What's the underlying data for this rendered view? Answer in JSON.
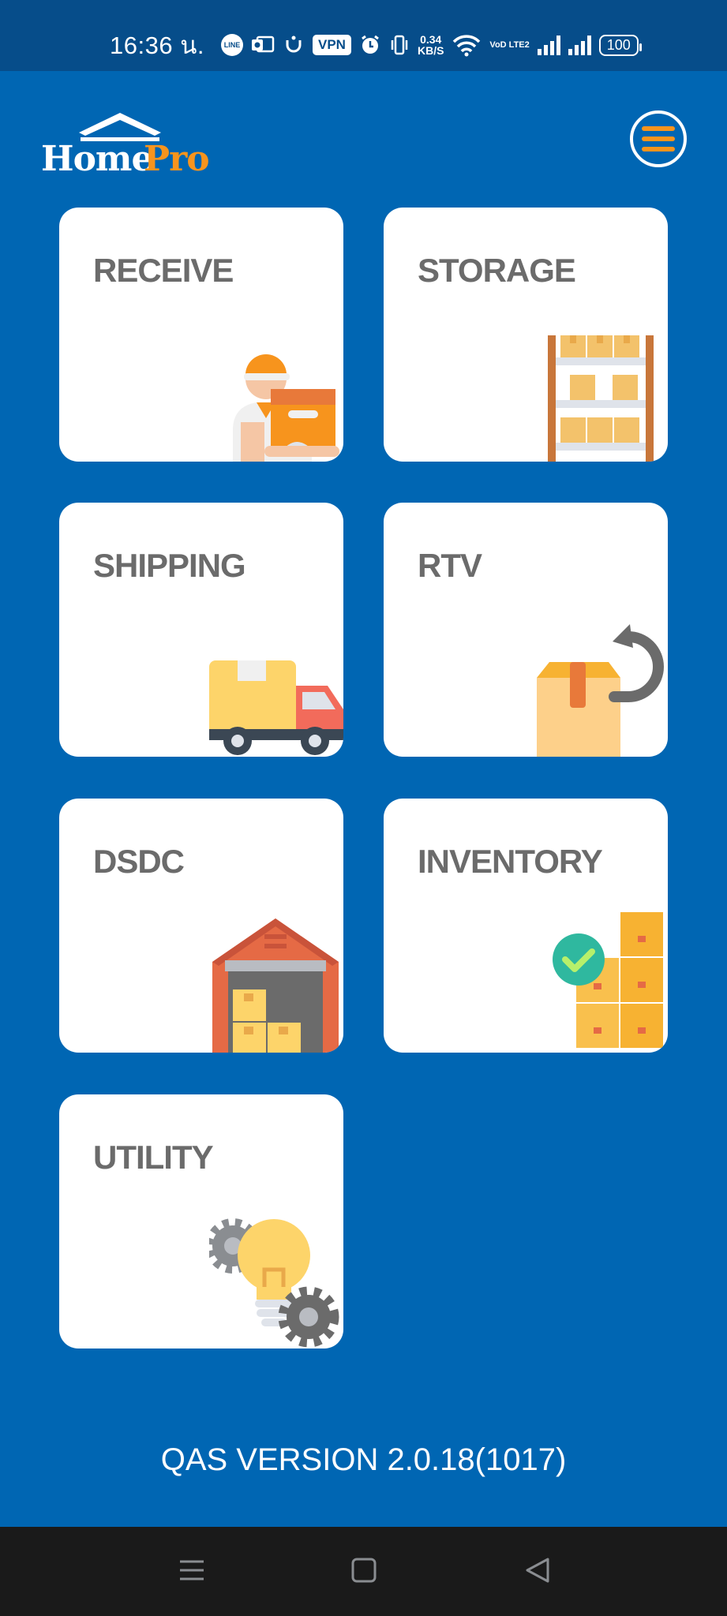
{
  "status_bar": {
    "time": "16:36 น.",
    "line_icon": "LINE",
    "vpn": "VPN",
    "net_speed_value": "0.34",
    "net_speed_unit": "KB/S",
    "volte": "VoD LTE2",
    "battery": "100",
    "icons": [
      "line-icon",
      "outlook-icon",
      "u-icon",
      "vpn-icon",
      "alarm-icon",
      "vibrate-icon",
      "wifi-icon",
      "signal-icon",
      "signal-icon",
      "battery-icon"
    ]
  },
  "header": {
    "logo_home": "Home",
    "logo_pro": "Pro",
    "menu_icon": "hamburger-menu-icon"
  },
  "menu_tiles": [
    {
      "label": "RECEIVE",
      "icon": "delivery-man-icon"
    },
    {
      "label": "STORAGE",
      "icon": "storage-shelf-icon"
    },
    {
      "label": "SHIPPING",
      "icon": "truck-icon"
    },
    {
      "label": "RTV",
      "icon": "return-box-icon"
    },
    {
      "label": "DSDC",
      "icon": "warehouse-icon"
    },
    {
      "label": "INVENTORY",
      "icon": "inventory-boxes-icon"
    },
    {
      "label": "UTILITY",
      "icon": "lightbulb-gears-icon"
    }
  ],
  "footer": {
    "version": "QAS VERSION 2.0.18(1017)"
  },
  "nav_bar": {
    "items": [
      "recent-apps-icon",
      "home-icon",
      "back-icon"
    ]
  },
  "colors": {
    "background": "#0066b3",
    "status_bar": "#064d8a",
    "accent_orange": "#f7941d",
    "tile": "#ffffff",
    "tile_text": "#6b6b6b",
    "nav_bar": "#1a1a1a"
  }
}
